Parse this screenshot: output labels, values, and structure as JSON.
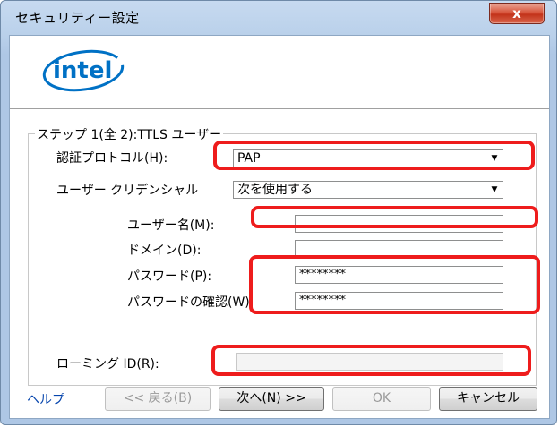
{
  "window": {
    "title": "セキュリティー設定",
    "close_glyph": "x"
  },
  "logo": {
    "text": "intel"
  },
  "step_group": {
    "legend": "ステップ 1(全 2):TTLS ユーザー"
  },
  "fields": {
    "auth_protocol": {
      "label": "認証プロトコル(H):",
      "value": "PAP"
    },
    "user_credential": {
      "label": "ユーザー クリデンシャル",
      "value": "次を使用する"
    },
    "username": {
      "label": "ユーザー名(M):",
      "value": ""
    },
    "domain": {
      "label": "ドメイン(D):",
      "value": ""
    },
    "password": {
      "label": "パスワード(P):",
      "value": "********"
    },
    "password_confirm": {
      "label": "パスワードの確認(W):",
      "value": "********"
    },
    "roaming_id": {
      "label": "ローミング ID(R):",
      "value": ""
    }
  },
  "buttons": {
    "help": "ヘルプ",
    "back": "<< 戻る(B)",
    "next": "次へ(N) >>",
    "ok": "OK",
    "cancel": "キャンセル"
  },
  "colors": {
    "highlight": "#ee1c1c",
    "intel_blue": "#0071c5",
    "link": "#0645ad"
  }
}
